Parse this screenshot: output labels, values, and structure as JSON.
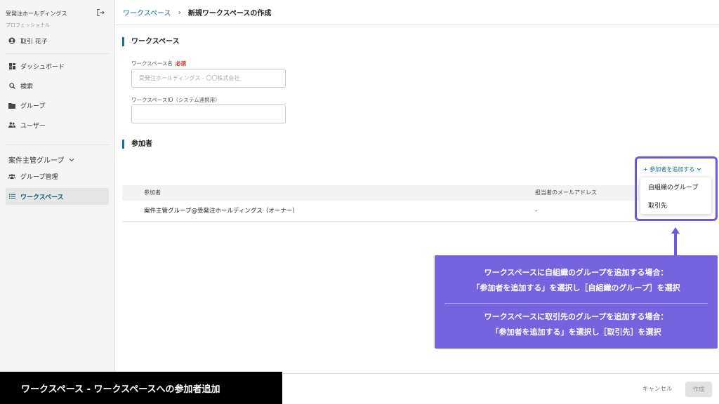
{
  "sidebar": {
    "org_name": "受発注ホールディングス",
    "plan": "プロフェッショナル",
    "user_name": "取引 花子",
    "items": [
      {
        "label": "ダッシュボード",
        "icon": "dashboard-icon"
      },
      {
        "label": "検索",
        "icon": "search-icon"
      },
      {
        "label": "グループ",
        "icon": "folder-icon"
      },
      {
        "label": "ユーザー",
        "icon": "users-icon"
      }
    ],
    "group_section": "案件主管グループ",
    "group_items": [
      {
        "label": "グループ管理",
        "icon": "group-icon"
      },
      {
        "label": "ワークスペース",
        "icon": "list-icon",
        "active": true
      }
    ]
  },
  "header": {
    "breadcrumb_link": "ワークスペース",
    "breadcrumb_current": "新規ワークスペースの作成"
  },
  "form": {
    "section_title": "ワークスペース",
    "name_label": "ワークスペース名",
    "required": "必須",
    "name_placeholder": "受発注ホールディングス - 〇〇株式会社",
    "id_label": "ワークスペースID（システム連携用）",
    "id_value": ""
  },
  "participants": {
    "section_title": "参加者",
    "add_button": "+ 参加者を追加する",
    "dropdown": [
      "自組織のグループ",
      "取引先"
    ],
    "columns": [
      "参加者",
      "担当者のメールアドレス"
    ],
    "rows": [
      {
        "name": "案件主管グループ@受発注ホールディングス（オーナー）",
        "email": "-"
      }
    ]
  },
  "callout": {
    "line1": "ワークスペースに自組織のグループを追加する場合：",
    "line2": "「参加者を追加する」を選択し［自組織のグループ］を選択",
    "line3": "ワークスペースに取引先のグループを追加する場合：",
    "line4": "「参加者を追加する」を選択し［取引先］を選択"
  },
  "footer": {
    "cancel": "キャンセル",
    "create": "作成"
  },
  "caption": "ワークスペース - ワークスペースへの参加者追加",
  "colors": {
    "accent": "#1f6f8b",
    "callout": "#7563e0",
    "highlight": "#6f55e0"
  }
}
